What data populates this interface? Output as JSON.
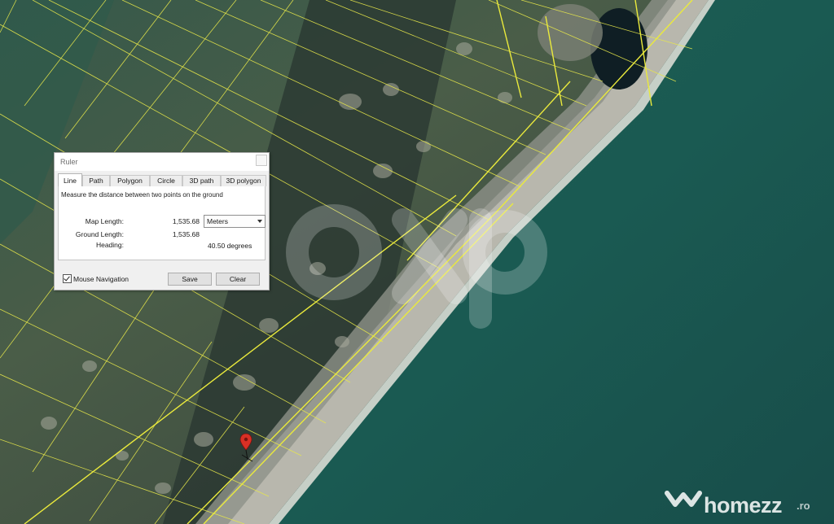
{
  "dialog": {
    "title": "Ruler",
    "tabs": [
      {
        "label": "Line",
        "active": true
      },
      {
        "label": "Path",
        "active": false
      },
      {
        "label": "Polygon",
        "active": false
      },
      {
        "label": "Circle",
        "active": false
      },
      {
        "label": "3D path",
        "active": false
      },
      {
        "label": "3D polygon",
        "active": false
      }
    ],
    "description": "Measure the distance between two points on the ground",
    "map_length_label": "Map Length:",
    "map_length_value": "1,535.68",
    "units_selected": "Meters",
    "ground_length_label": "Ground Length:",
    "ground_length_value": "1,535.68",
    "heading_label": "Heading:",
    "heading_value": "40.50 degrees",
    "mouse_navigation_label": "Mouse Navigation",
    "mouse_navigation_checked": true,
    "save_label": "Save",
    "clear_label": "Clear"
  },
  "watermark": {
    "brand": "homezz",
    "tld": ".ro",
    "center_logo": "exp"
  },
  "icons": {
    "placemark": "map-pin-icon",
    "brand_logo": "homezz-logo-icon",
    "check": "checkmark-icon"
  },
  "colors": {
    "parcel_lines": "#e8e84a",
    "placemark": "#d93025",
    "sea": "#1e5a52",
    "land": "#3f5a44"
  }
}
